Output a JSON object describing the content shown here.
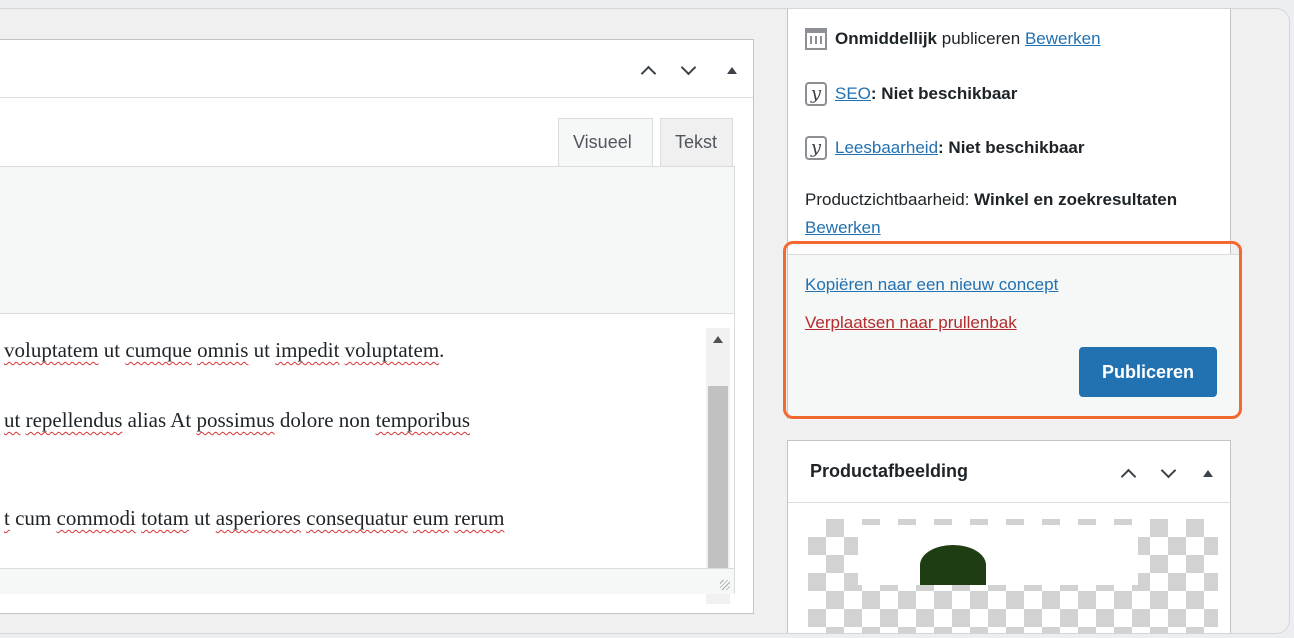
{
  "editor": {
    "tabs": {
      "visual": "Visueel",
      "text": "Tekst"
    },
    "content_lines": [
      [
        "voluptatem",
        " ut ",
        "cumque",
        " ",
        "omnis",
        " ut ",
        "impedit",
        " ",
        "voluptatem",
        "."
      ],
      [
        "ut",
        " ",
        "repellendus",
        " alias At ",
        "possimus",
        " dolore non ",
        "temporibus",
        ""
      ],
      [
        "t",
        " cum ",
        "commodi",
        " ",
        "totam",
        " ut ",
        "asperiores",
        " ",
        "consequatur",
        " ",
        "eum",
        " ",
        "rerum"
      ]
    ]
  },
  "publish": {
    "schedule": {
      "value": "Onmiddellijk",
      "text": "publiceren",
      "edit": "Bewerken"
    },
    "seo": {
      "label": "SEO",
      "value": ": Niet beschikbaar"
    },
    "readability": {
      "label": "Leesbaarheid",
      "value": ": Niet beschikbaar"
    },
    "visibility": {
      "label": "Productzichtbaarheid: ",
      "value": "Winkel en zoekresultaten",
      "edit": "Bewerken"
    },
    "copy_link": "Kopiëren naar een nieuw concept",
    "trash_link": "Verplaatsen naar prullenbak",
    "publish_button": "Publiceren"
  },
  "product_image": {
    "title": "Productafbeelding"
  },
  "colors": {
    "accent": "#2271b1",
    "danger": "#b32d2e",
    "highlight": "#f26a2f"
  }
}
